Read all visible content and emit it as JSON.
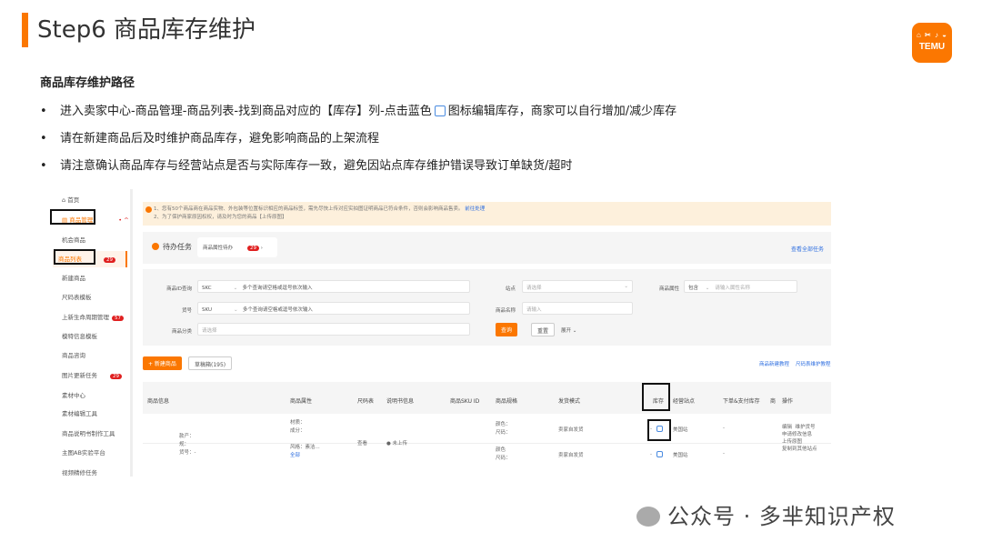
{
  "slide": {
    "title": "Step6 商品库存维护",
    "logo_text": "TEMU",
    "subtitle": "商品库存维护路径",
    "bullets": [
      {
        "pre": "进入卖家中心-商品管理-商品列表-找到商品对应的【库存】列-点击蓝色",
        "post": "图标编辑库存，商家可以自行增加/减少库存"
      },
      {
        "pre": "请在新建商品后及时维护商品库存，避免影响商品的上架流程",
        "post": ""
      },
      {
        "pre": "请注意确认商品库存与经营站点是否与实际库存一致，避免因站点库存维护错误导致订单缺货/超时",
        "post": ""
      }
    ],
    "watermark": "公众号 · 多芈知识产权"
  },
  "sidebar": {
    "items": [
      {
        "label": "首页"
      },
      {
        "label": "商品管理"
      },
      {
        "label": "机会商品"
      },
      {
        "label": "商品列表",
        "badge": "29"
      },
      {
        "label": "新建商品"
      },
      {
        "label": "尺码表模板"
      },
      {
        "label": "上新生命周期管理",
        "badge": "57"
      },
      {
        "label": "模特信息模板"
      },
      {
        "label": "商品咨询"
      },
      {
        "label": "图片更新任务",
        "badge": "29"
      },
      {
        "label": "素材中心"
      },
      {
        "label": "素材编辑工具"
      },
      {
        "label": "商品说明书制作工具"
      },
      {
        "label": "主图AB实验平台"
      },
      {
        "label": "视频精修任务"
      }
    ]
  },
  "alert": {
    "line1": "1、您有50个商品商在商品实物、外包装等位置标识相应的商品标签，需先尽快上传对应实拍图证明商品已符合条件，否则会影响商品售卖。",
    "link1": "前往处理",
    "line2": "2、为了保护商家原因权权，请及时为您的商品【上传原图】"
  },
  "todo": {
    "title": "待办任务",
    "item": "商品属性待办",
    "count": "29",
    "view_all": "查看全部任务"
  },
  "filters": {
    "id_label": "商品ID查询",
    "id_type": "SKC",
    "id_placeholder": "多个查询请空格或逗号依次输入",
    "code_label": "货号",
    "code_type": "SKU",
    "code_placeholder": "多个查询请空格或逗号依次输入",
    "cat_label": "商品分类",
    "cat_placeholder": "请选择",
    "site_label": "站点",
    "site_placeholder": "请选择",
    "name_label": "商品名称",
    "name_placeholder": "请输入",
    "attr_label": "商品属性",
    "attr_op": "包含",
    "attr_placeholder": "请输入属性名称",
    "search": "查询",
    "reset": "重置",
    "expand": "展开"
  },
  "actions": {
    "new": "+ 新建商品",
    "draft": "草稿箱(195)",
    "guide1": "商品新建教程",
    "guide2": "尺码表维护教程"
  },
  "table": {
    "headers": [
      "商品信息",
      "商品属性",
      "尺码表",
      "说明书信息",
      "商品SKU ID",
      "商品规格",
      "发货模式",
      "库存",
      "经营站点",
      "下单&支付库存",
      "商",
      "操作"
    ],
    "rows": [
      {
        "attr": [
          "材质：",
          "成分：",
          "风格：素洁...",
          "全部"
        ],
        "size_table": "查看",
        "manual": "● 未上传",
        "spec": [
          "颜色：",
          "尺码："
        ],
        "ship": "卖家自发货",
        "stock": "-",
        "site": "美国站",
        "paid": "-",
        "ops": [
          "编辑",
          "维护货号",
          "申请修改信息"
        ]
      },
      {
        "spec": [
          "颜色",
          "尺码："
        ],
        "ship": "卖家自发货",
        "stock": "-",
        "site": "美国站",
        "paid": "-",
        "ops": [
          "上传原图",
          "复制到其他站点"
        ]
      }
    ],
    "info": [
      "款产：",
      "规：",
      "货号：-"
    ]
  }
}
